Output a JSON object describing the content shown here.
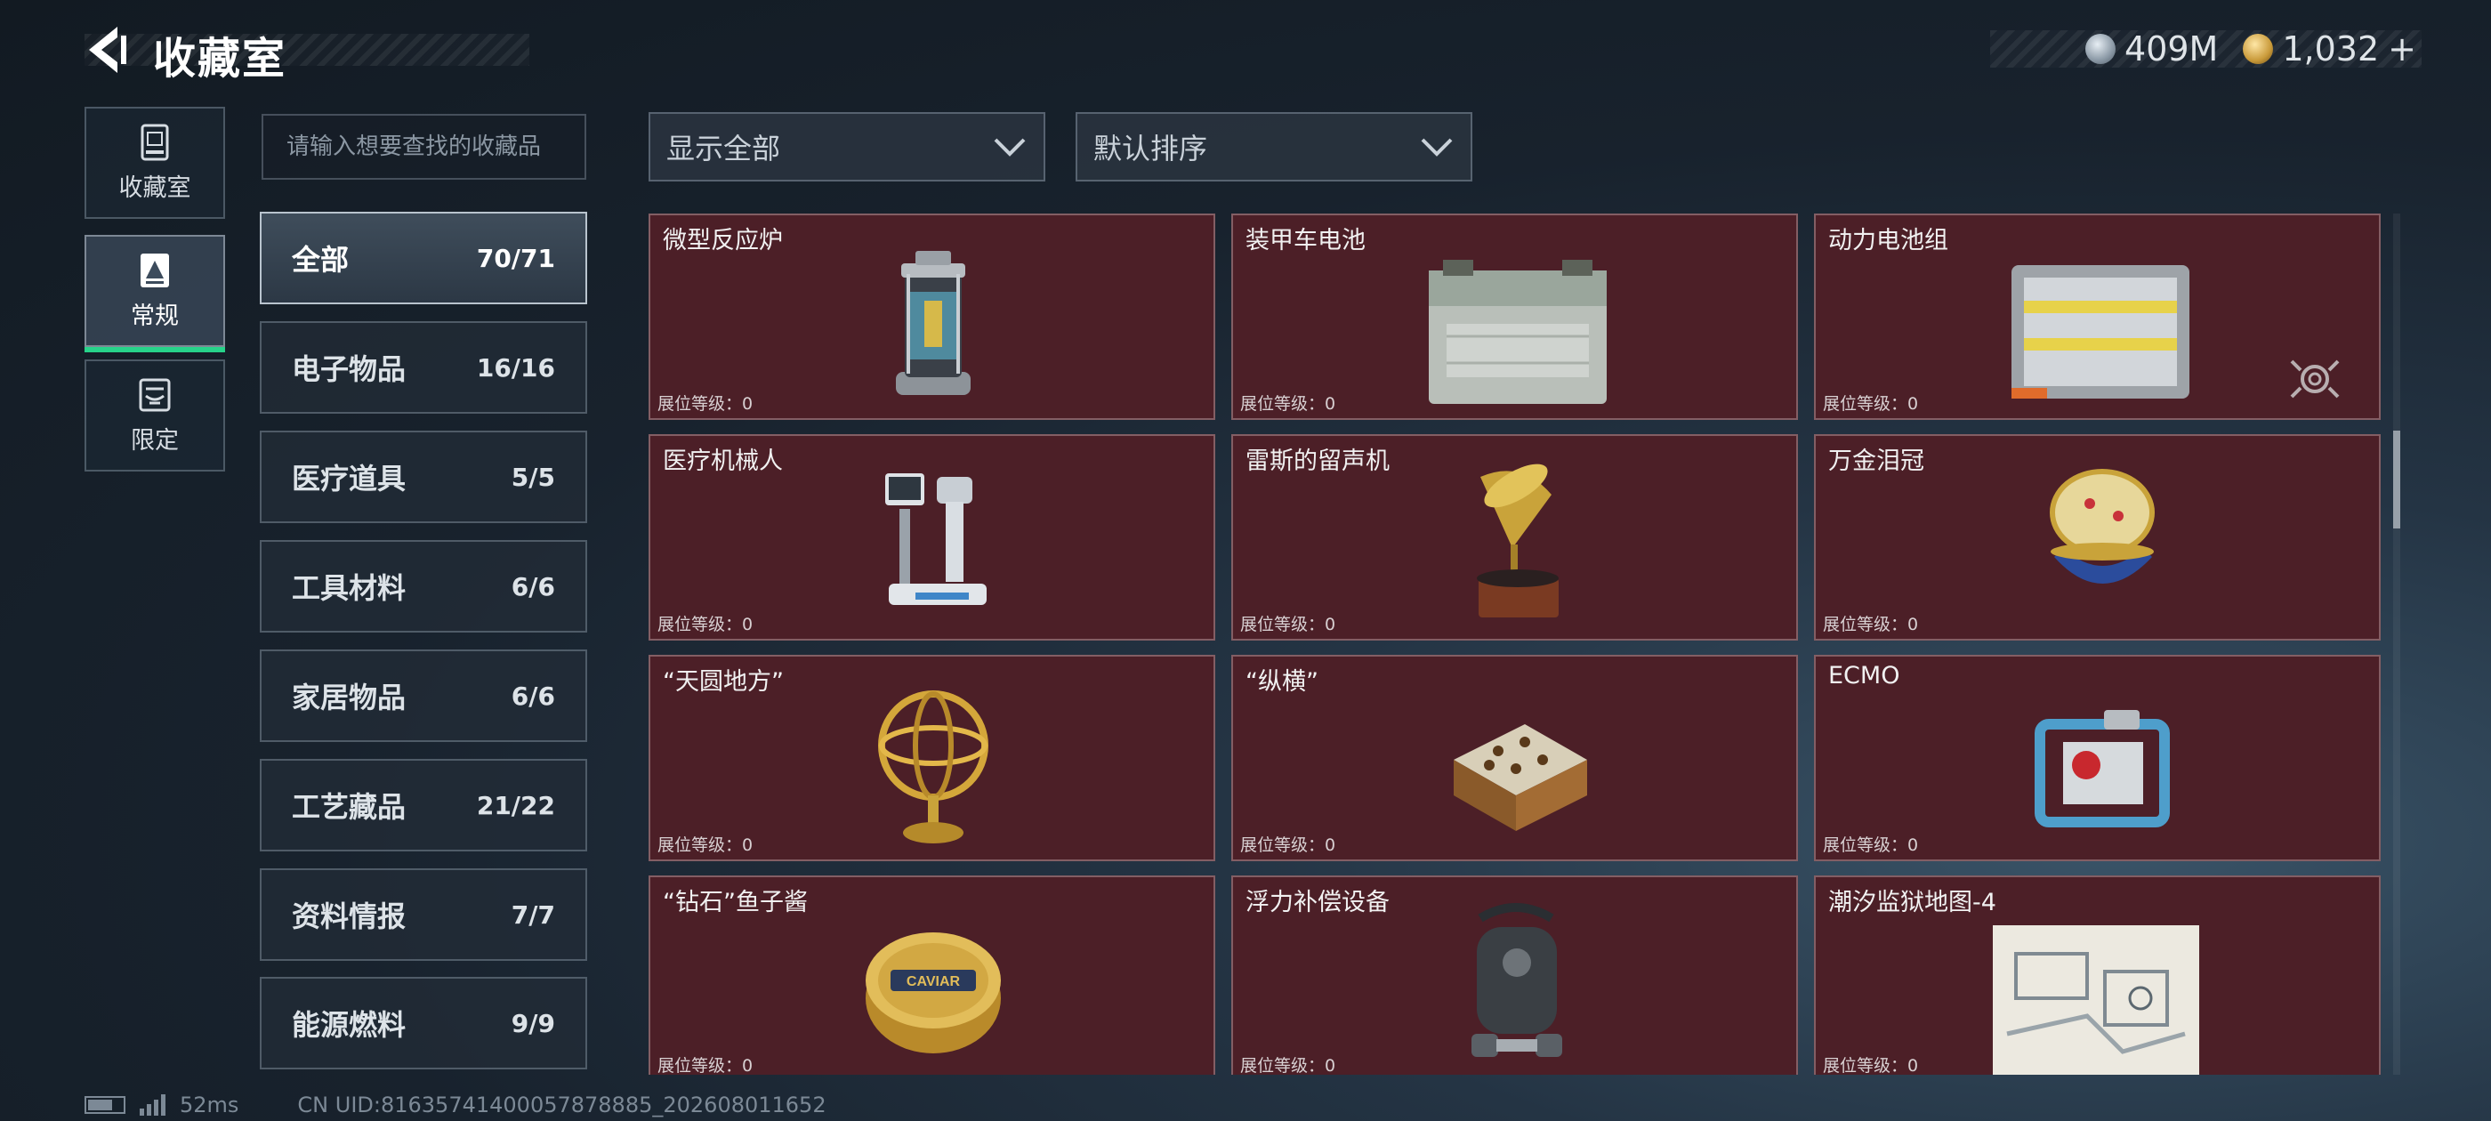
{
  "header": {
    "title": "收藏室"
  },
  "currency": {
    "silver": "409M",
    "gold": "1,032",
    "add": "+"
  },
  "left_nav": [
    {
      "label": "收藏室",
      "icon": "collection-room-icon",
      "active": false
    },
    {
      "label": "常规",
      "icon": "regular-icon",
      "active": true
    },
    {
      "label": "限定",
      "icon": "limited-icon",
      "active": false
    }
  ],
  "search": {
    "placeholder": "请输入想要查找的收藏品"
  },
  "filters": {
    "show": "显示全部",
    "sort": "默认排序"
  },
  "categories": [
    {
      "label": "全部",
      "count": "70/71",
      "active": true
    },
    {
      "label": "电子物品",
      "count": "16/16"
    },
    {
      "label": "医疗道具",
      "count": "5/5"
    },
    {
      "label": "工具材料",
      "count": "6/6"
    },
    {
      "label": "家居物品",
      "count": "6/6"
    },
    {
      "label": "工艺藏品",
      "count": "21/22"
    },
    {
      "label": "资料情报",
      "count": "7/7"
    },
    {
      "label": "能源燃料",
      "count": "9/9"
    }
  ],
  "items": [
    {
      "name": "微型反应炉",
      "level": "展位等级：0",
      "icon": "micro-reactor-icon"
    },
    {
      "name": "装甲车电池",
      "level": "展位等级：0",
      "icon": "vehicle-battery-icon"
    },
    {
      "name": "动力电池组",
      "level": "展位等级：0",
      "icon": "battery-pack-icon"
    },
    {
      "name": "医疗机械人",
      "level": "展位等级：0",
      "icon": "medical-robot-icon"
    },
    {
      "name": "雷斯的留声机",
      "level": "展位等级：0",
      "icon": "gramophone-icon"
    },
    {
      "name": "万金泪冠",
      "level": "展位等级：0",
      "icon": "jeweled-egg-icon"
    },
    {
      "name": "“天圆地方”",
      "level": "展位等级：0",
      "icon": "armillary-sphere-icon"
    },
    {
      "name": "“纵横”",
      "level": "展位等级：0",
      "icon": "chess-box-icon"
    },
    {
      "name": "ECMO",
      "level": "展位等级：0",
      "icon": "ecmo-icon"
    },
    {
      "name": "“钻石”鱼子酱",
      "level": "展位等级：0",
      "icon": "caviar-tin-icon"
    },
    {
      "name": "浮力补偿设备",
      "level": "展位等级：0",
      "icon": "buoyancy-device-icon"
    },
    {
      "name": "潮汐监狱地图-4",
      "level": "展位等级：0",
      "icon": "prison-map-icon"
    }
  ],
  "item_images": {
    "caviar_label": "CAVIAR"
  },
  "footer": {
    "ping": "52ms",
    "uid": "CN UID:81635741400057878885_202608011652"
  },
  "colors": {
    "card_bg": "#4c1f27",
    "active_tab": "#27d38a"
  }
}
